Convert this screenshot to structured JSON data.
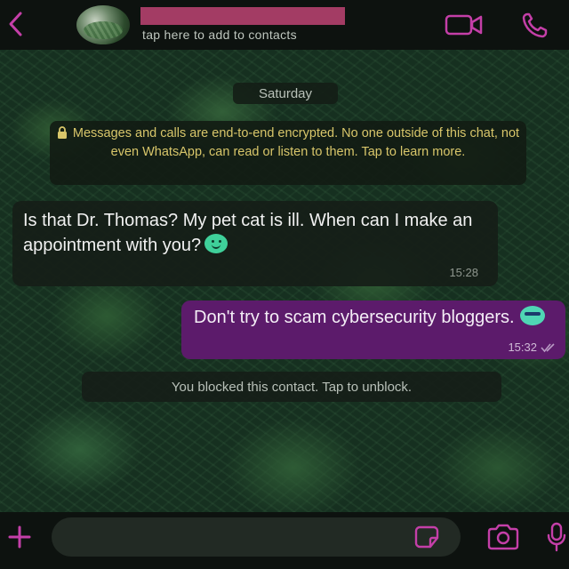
{
  "header": {
    "contact_subtitle": "tap here to add to contacts",
    "accent_color": "#c43fa8",
    "icons": [
      "back-arrow-icon",
      "video-call-icon",
      "phone-call-icon"
    ]
  },
  "chat": {
    "date_label": "Saturday",
    "encryption_notice": "Messages and calls are end-to-end encrypted. No one outside of this chat, not even WhatsApp, can read or listen to them. Tap to learn more.",
    "messages": [
      {
        "direction": "incoming",
        "text": "Is that Dr. Thomas? My pet cat is ill. When can I make an appointment with you?",
        "time": "15:28"
      },
      {
        "direction": "outgoing",
        "text": "Don't try to scam cybersecurity bloggers.",
        "time": "15:32",
        "status_icon": "double-check-icon"
      }
    ],
    "blocked_notice": "You blocked this contact. Tap to unblock."
  },
  "composer": {
    "placeholder": "",
    "icons": [
      "plus-icon",
      "sticker-icon",
      "camera-icon",
      "microphone-icon"
    ]
  }
}
